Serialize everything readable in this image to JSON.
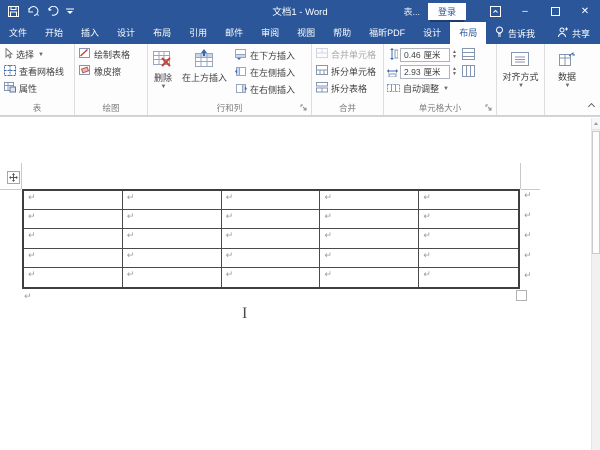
{
  "titlebar": {
    "title": "文档1 - Word",
    "contextual_tools_label": "表...",
    "sign_in": "登录",
    "window_controls": [
      "ribbon-display-options",
      "minimize",
      "maximize",
      "close"
    ],
    "quick_access": [
      "save",
      "undo",
      "redo",
      "customize-quick-access"
    ]
  },
  "tabs": {
    "file": "文件",
    "main": [
      "开始",
      "插入",
      "设计",
      "布局",
      "引用",
      "邮件",
      "审阅",
      "视图",
      "帮助",
      "福昕PDF"
    ],
    "contextual": [
      "设计",
      "布局"
    ],
    "active_contextual": "布局",
    "tell_me": "告诉我",
    "share": "共享"
  },
  "ribbon": {
    "table_group": {
      "label": "表",
      "select": "选择",
      "view_gridlines": "查看网格线",
      "properties": "属性"
    },
    "draw_group": {
      "label": "绘图",
      "draw_table": "绘制表格",
      "eraser": "橡皮擦"
    },
    "rows_cols_group": {
      "label": "行和列",
      "delete": "删除",
      "insert_above": "在上方插入",
      "insert_below": "在下方插入",
      "insert_left": "在左侧插入",
      "insert_right": "在右侧插入"
    },
    "merge_group": {
      "label": "合并",
      "merge_cells": "合并单元格",
      "split_cells": "拆分单元格",
      "split_table": "拆分表格"
    },
    "cell_size_group": {
      "label": "单元格大小",
      "height_value": "0.46",
      "width_value": "2.93",
      "unit": "厘米",
      "autofit": "自动调整"
    },
    "alignment_group": {
      "label": "对齐方式"
    },
    "data_group": {
      "label": "数据"
    }
  },
  "document": {
    "table": {
      "rows": 5,
      "cols": 5,
      "end_of_cell_marker": "↵",
      "row_end_marker": "↵"
    },
    "paragraph_marker": "↵"
  },
  "icons": {
    "save": "floppy-outline",
    "undo": "arc-arrow-left",
    "redo": "arc-arrow-right",
    "tell_me": "lightbulb",
    "share": "person-plus",
    "delete_table": "table-with-red-x",
    "insert_above": "table-with-blue-up-arrow",
    "move_handle": "four-way-arrow-cross",
    "text_cursor": "i-beam"
  },
  "colors": {
    "accent": "#2b579a",
    "titlebar_bg": "#2b579a",
    "active_tab_bg": "#ffffff",
    "contextual_strip": "#1e3c6e",
    "ribbon_bg": "#fdfdfe",
    "table_border": "#4a4a4a",
    "marker_gray": "#9b9b9b",
    "icon_bluegray": "#8496b0",
    "icon_red": "#c5443c",
    "icon_blue": "#3a67ad"
  }
}
